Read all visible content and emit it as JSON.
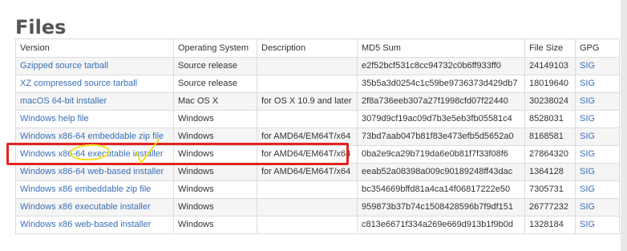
{
  "page": {
    "title": "Files"
  },
  "table": {
    "headers": [
      "Version",
      "Operating System",
      "Description",
      "MD5 Sum",
      "File Size",
      "GPG"
    ],
    "rows": [
      {
        "version": "Gzipped source tarball",
        "os": "Source release",
        "description": "",
        "md5": "e2f52bcf531c8cc94732c0b6ff933ff0",
        "size": "24149103",
        "gpg": "SIG"
      },
      {
        "version": "XZ compressed source tarball",
        "os": "Source release",
        "description": "",
        "md5": "35b5a3d0254c1c59be9736373d429db7",
        "size": "18019640",
        "gpg": "SIG"
      },
      {
        "version": "macOS 64-bit installer",
        "os": "Mac OS X",
        "description": "for OS X 10.9 and later",
        "md5": "2f8a736eeb307a27f1998cfd07f22440",
        "size": "30238024",
        "gpg": "SIG"
      },
      {
        "version": "Windows help file",
        "os": "Windows",
        "description": "",
        "md5": "3079d9cf19ac09d7b3e5eb3fb05581c4",
        "size": "8528031",
        "gpg": "SIG"
      },
      {
        "version": "Windows x86-64 embeddable zip file",
        "os": "Windows",
        "description": "for AMD64/EM64T/x64",
        "md5": "73bd7aab047b81f83e473efb5d5652a0",
        "size": "8168581",
        "gpg": "SIG"
      },
      {
        "version": "Windows x86-64 executable installer",
        "os": "Windows",
        "description": "for AMD64/EM64T/x64",
        "md5": "0ba2e9ca29b719da6e0b81f7f33f08f6",
        "size": "27864320",
        "gpg": "SIG"
      },
      {
        "version": "Windows x86-64 web-based installer",
        "os": "Windows",
        "description": "for AMD64/EM64T/x64",
        "md5": "eeab52a08398a009c90189248ff43dac",
        "size": "1364128",
        "gpg": "SIG"
      },
      {
        "version": "Windows x86 embeddable zip file",
        "os": "Windows",
        "description": "",
        "md5": "bc354669bffd81a4ca14f06817222e50",
        "size": "7305731",
        "gpg": "SIG"
      },
      {
        "version": "Windows x86 executable installer",
        "os": "Windows",
        "description": "",
        "md5": "959873b37b74c1508428596b7f9df151",
        "size": "26777232",
        "gpg": "SIG"
      },
      {
        "version": "Windows x86 web-based installer",
        "os": "Windows",
        "description": "",
        "md5": "c813e6671f334a269e669d913b1f9b0d",
        "size": "1328184",
        "gpg": "SIG"
      }
    ]
  },
  "colors": {
    "link": "#3a6fb7",
    "highlight_box": "#e52220",
    "annotation_pen": "#f2e01f"
  }
}
